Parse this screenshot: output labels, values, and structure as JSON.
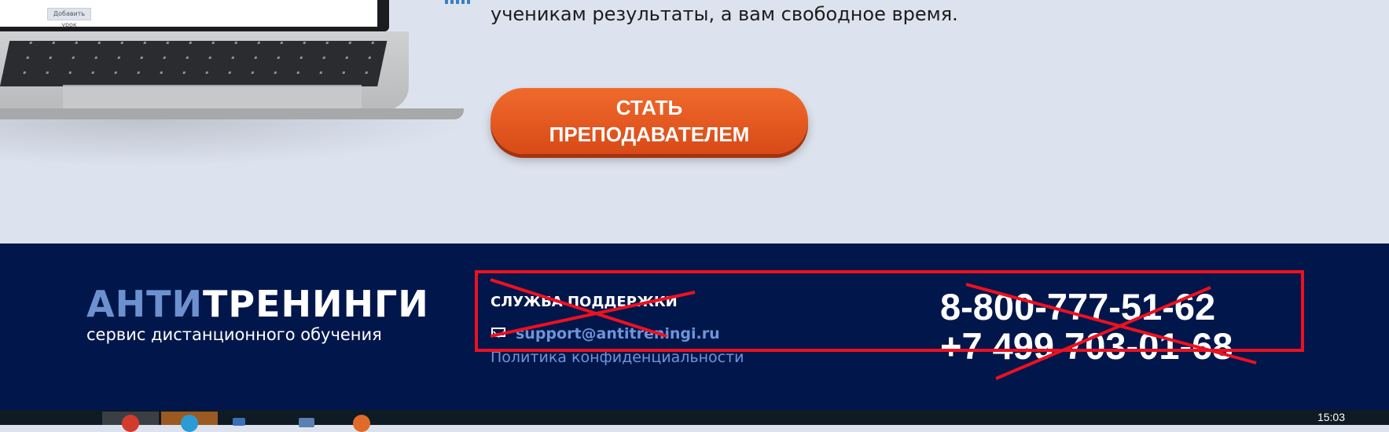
{
  "hero": {
    "subtitle": "ученикам результаты, а вам свободное время.",
    "cta_line1": "СТАТЬ",
    "cta_line2": "ПРЕПОДАВАТЕЛЕМ",
    "screen_button": "Добавить урок"
  },
  "footer": {
    "logo_part1": "АНТИ",
    "logo_part2": "ТРЕНИНГИ",
    "logo_subtitle": "сервис дистанционного обучения",
    "support_title": "СЛУЖБА ПОДДЕРЖКИ",
    "email": "support@antitreningi.ru",
    "privacy_link": "Политика конфиденциальности",
    "phone1": "8-800-777-51-62",
    "phone2": "+7 499 703-01-68"
  },
  "taskbar": {
    "clock": "15:03"
  },
  "colors": {
    "footer_bg": "#01174b",
    "accent_blue": "#6f94d8",
    "cta_orange": "#e55a20",
    "annotation_red": "#ee1020"
  }
}
